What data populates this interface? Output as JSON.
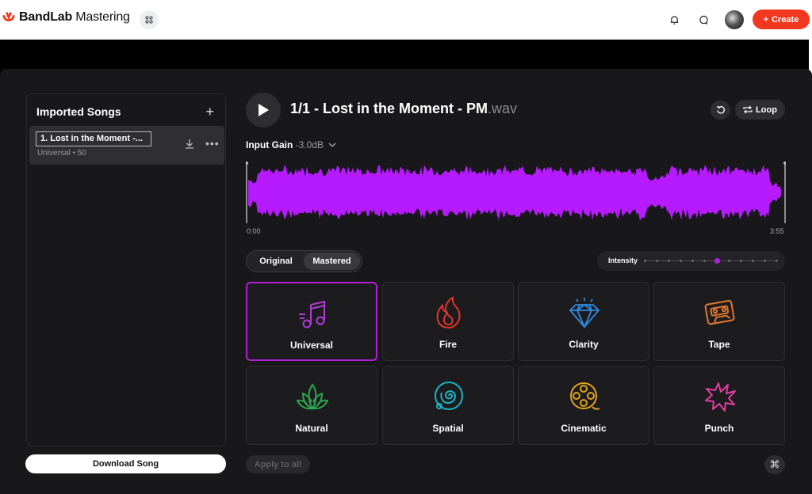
{
  "header": {
    "brand_bold": "BandLab",
    "brand_light": "Mastering",
    "create_label": "Create",
    "icons": [
      "bandlab-logo-icon",
      "apps-grid-icon",
      "bell-icon",
      "chat-icon",
      "avatar",
      "plus-icon"
    ]
  },
  "sidebar": {
    "title": "Imported Songs",
    "add_icon": "+",
    "songs": [
      {
        "title": "1. Lost in the Moment -...",
        "meta": "Universal • 50"
      }
    ],
    "download_label": "Download Song"
  },
  "player": {
    "track_name": "1/1 - Lost in the Moment - PM",
    "track_ext": ".wav",
    "loop_label": "Loop",
    "input_gain_label": "Input Gain",
    "input_gain_value": "-3.0dB",
    "time_start": "0:00",
    "time_end": "3:55"
  },
  "compare": {
    "original_label": "Original",
    "mastered_label": "Mastered",
    "selected": "Mastered"
  },
  "intensity": {
    "label": "Intensity",
    "steps": 12,
    "value_index": 6
  },
  "presets": [
    {
      "label": "Universal",
      "icon": "music-note-icon",
      "color": "#b23ad6",
      "selected": true
    },
    {
      "label": "Fire",
      "icon": "flame-icon",
      "color": "#e2352a",
      "selected": false
    },
    {
      "label": "Clarity",
      "icon": "diamond-icon",
      "color": "#2f8be0",
      "selected": false
    },
    {
      "label": "Tape",
      "icon": "cassette-icon",
      "color": "#e3782a",
      "selected": false
    },
    {
      "label": "Natural",
      "icon": "lotus-icon",
      "color": "#2ea44f",
      "selected": false
    },
    {
      "label": "Spatial",
      "icon": "spiral-icon",
      "color": "#19b6c8",
      "selected": false
    },
    {
      "label": "Cinematic",
      "icon": "film-reel-icon",
      "color": "#e0a21c",
      "selected": false
    },
    {
      "label": "Punch",
      "icon": "burst-icon",
      "color": "#e23ca2",
      "selected": false
    }
  ],
  "footer": {
    "apply_label": "Apply to all",
    "shortcut_icon": "⌘"
  },
  "colors": {
    "accent": "#b11fd8",
    "waveform": "#b61aff",
    "create": "#f2371f"
  }
}
